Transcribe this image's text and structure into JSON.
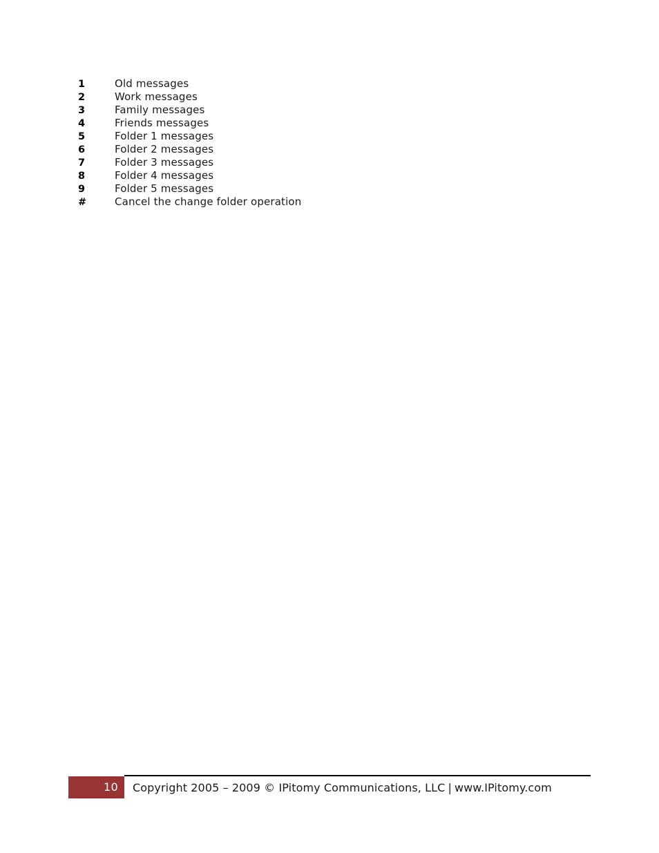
{
  "document": {
    "page_number": "10",
    "background_color": "#ffffff",
    "text_color": "#1a1a1a"
  },
  "main": {
    "key_list": [
      {
        "key": "1",
        "label": "Old messages"
      },
      {
        "key": "2",
        "label": "Work messages"
      },
      {
        "key": "3",
        "label": "Family messages"
      },
      {
        "key": "4",
        "label": "Friends messages"
      },
      {
        "key": "5",
        "label": "Folder 1 messages"
      },
      {
        "key": "6",
        "label": "Folder 2 messages"
      },
      {
        "key": "7",
        "label": "Folder 3 messages"
      },
      {
        "key": "8",
        "label": "Folder 4 messages"
      },
      {
        "key": "9",
        "label": "Folder 5 messages"
      },
      {
        "key": "#",
        "label": "Cancel the change folder operation"
      }
    ]
  },
  "footer": {
    "page_number": "10",
    "page_number_box_color": "#983433",
    "page_number_text_color": "#ffffff",
    "copyright": "Copyright 2005 – 2009 © IPitomy Communications, LLC",
    "separator": "|",
    "website": "www.IPitomy.com"
  }
}
